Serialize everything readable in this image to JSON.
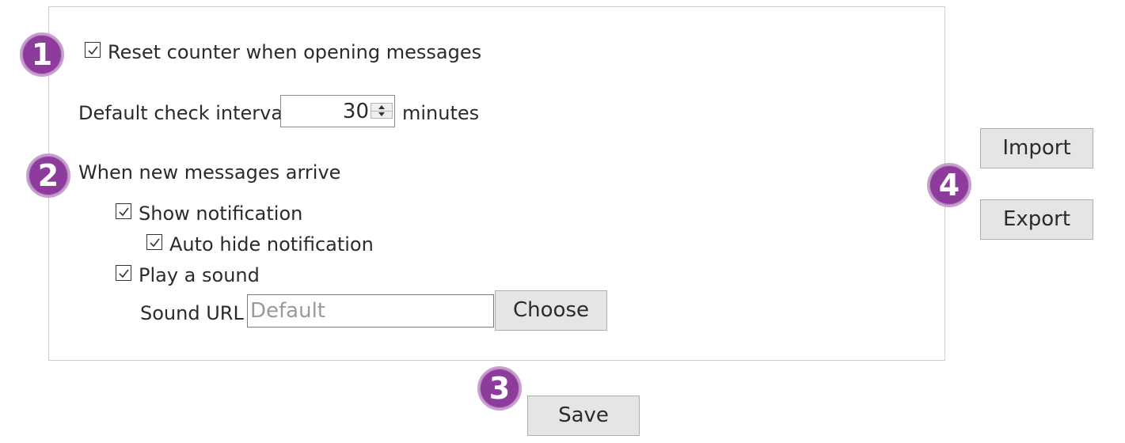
{
  "settings": {
    "reset_counter_label": "Reset counter when opening messages",
    "reset_counter_checked": true,
    "check_interval_label": "Default check interval",
    "check_interval_value": "30",
    "check_interval_unit": "minutes",
    "new_messages_heading": "When new messages arrive",
    "show_notification_label": "Show notification",
    "show_notification_checked": true,
    "auto_hide_label": "Auto hide notification",
    "auto_hide_checked": true,
    "play_sound_label": "Play a sound",
    "play_sound_checked": true,
    "sound_url_label": "Sound URL",
    "sound_url_value": "",
    "sound_url_placeholder": "Default",
    "choose_label": "Choose"
  },
  "actions": {
    "save_label": "Save",
    "import_label": "Import",
    "export_label": "Export"
  },
  "callouts": {
    "one": "1",
    "two": "2",
    "three": "3",
    "four": "4"
  },
  "colors": {
    "callout_fill": "#8e3c9c",
    "callout_ring": "#c7a0cf",
    "button_bg": "#e5e5e5"
  }
}
